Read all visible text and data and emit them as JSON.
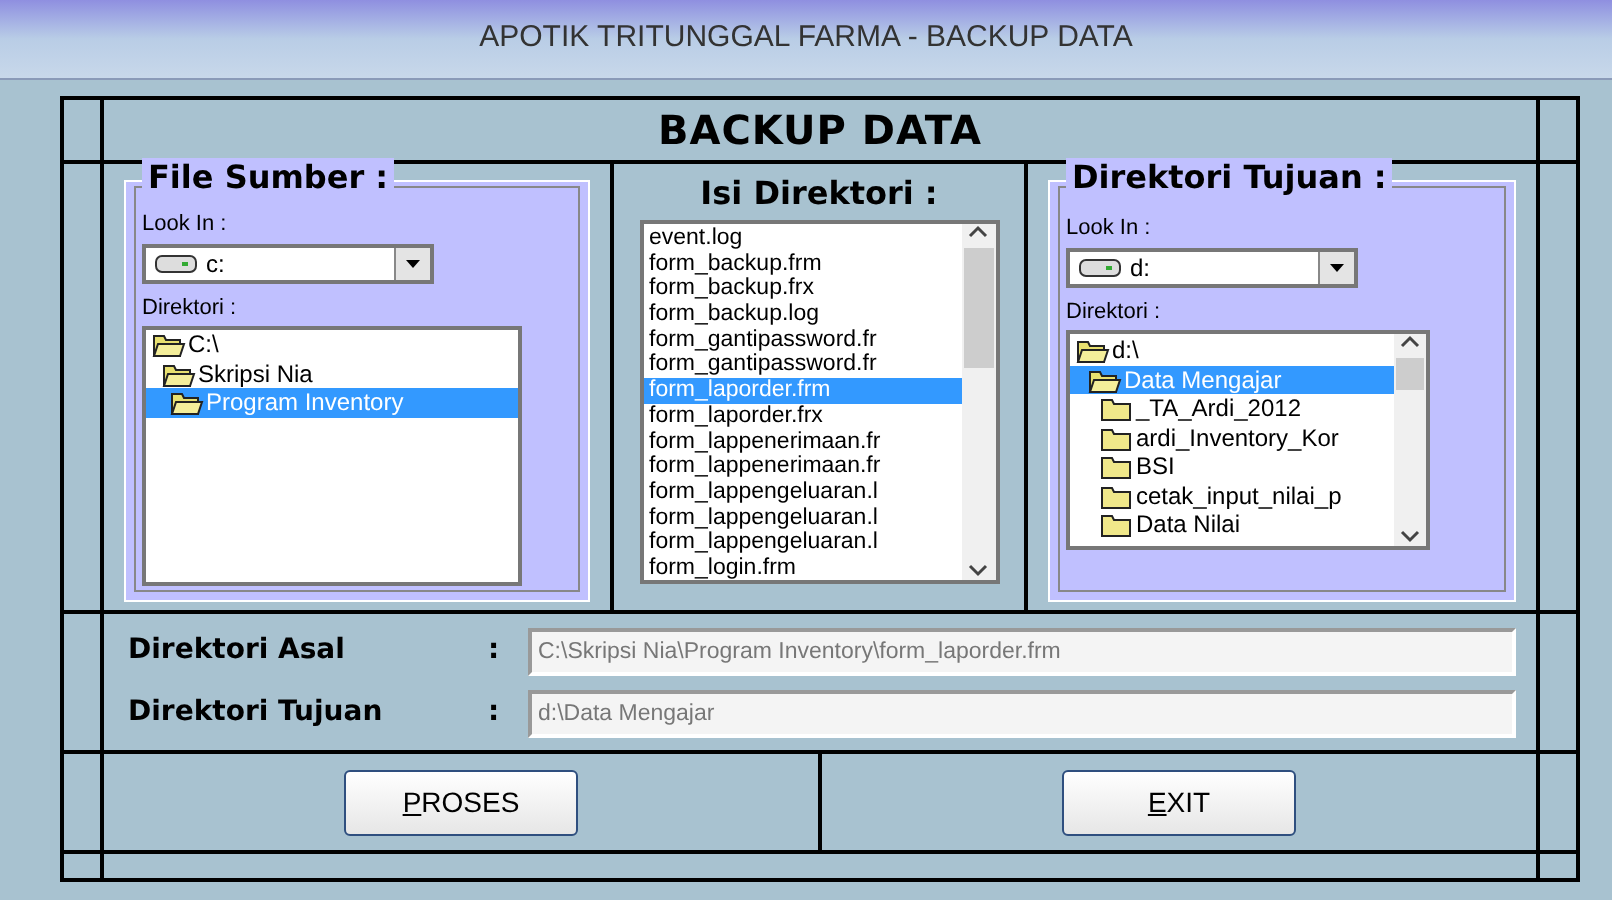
{
  "window": {
    "title": "APOTIK TRITUNGGAL FARMA - BACKUP DATA"
  },
  "heading": "BACKUP DATA",
  "source": {
    "title": "File Sumber :",
    "look_in_label": "Look In :",
    "drive": "c:",
    "dir_label": "Direktori :",
    "tree": [
      {
        "label": "C:\\",
        "open": true,
        "selected": false,
        "children": [
          {
            "label": "Skripsi Nia",
            "open": true,
            "selected": false,
            "children": [
              {
                "label": "Program Inventory",
                "open": true,
                "selected": true
              }
            ]
          }
        ]
      }
    ]
  },
  "files": {
    "title": "Isi Direktori :",
    "items": [
      {
        "label": "event.log",
        "selected": false
      },
      {
        "label": "form_backup.frm",
        "selected": false
      },
      {
        "label": "form_backup.frx",
        "selected": false
      },
      {
        "label": "form_backup.log",
        "selected": false
      },
      {
        "label": "form_gantipassword.fr",
        "selected": false
      },
      {
        "label": "form_gantipassword.fr",
        "selected": false
      },
      {
        "label": "form_laporder.frm",
        "selected": true
      },
      {
        "label": "form_laporder.frx",
        "selected": false
      },
      {
        "label": "form_lappenerimaan.fr",
        "selected": false
      },
      {
        "label": "form_lappenerimaan.fr",
        "selected": false
      },
      {
        "label": "form_lappengeluaran.l",
        "selected": false
      },
      {
        "label": "form_lappengeluaran.l",
        "selected": false
      },
      {
        "label": "form_lappengeluaran.l",
        "selected": false
      },
      {
        "label": "form_login.frm",
        "selected": false
      }
    ]
  },
  "target": {
    "title": "Direktori Tujuan :",
    "look_in_label": "Look In :",
    "drive": "d:",
    "dir_label": "Direktori :",
    "tree": [
      {
        "label": "d:\\",
        "open": true,
        "selected": false,
        "children": [
          {
            "label": "Data Mengajar",
            "open": true,
            "selected": true,
            "children": [
              {
                "label": "_TA_Ardi_2012",
                "open": false,
                "selected": false
              },
              {
                "label": "ardi_Inventory_Kor",
                "open": false,
                "selected": false
              },
              {
                "label": "BSI",
                "open": false,
                "selected": false
              },
              {
                "label": "cetak_input_nilai_p",
                "open": false,
                "selected": false
              },
              {
                "label": "Data Nilai",
                "open": false,
                "selected": false
              }
            ]
          }
        ]
      }
    ]
  },
  "fields": [
    {
      "label": "Direktori Asal",
      "colon": ":",
      "value": "C:\\Skripsi Nia\\Program Inventory\\form_laporder.frm"
    },
    {
      "label": "Direktori Tujuan",
      "colon": ":",
      "value": "d:\\Data Mengajar"
    }
  ],
  "buttons": [
    {
      "mnemonic": "P",
      "rest": "ROSES"
    },
    {
      "mnemonic": "E",
      "rest": "XIT"
    }
  ]
}
